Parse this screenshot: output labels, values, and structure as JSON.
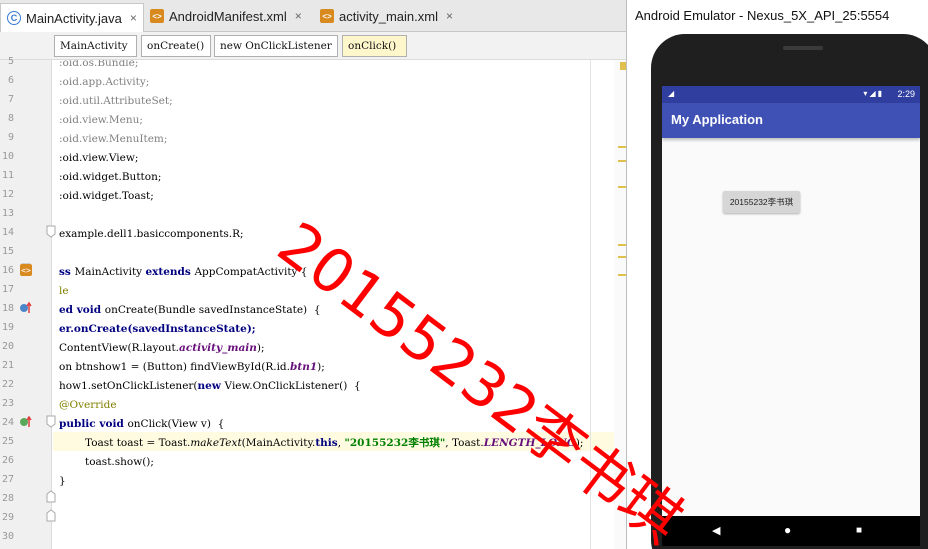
{
  "ide": {
    "tabs": [
      {
        "label": "MainActivity.java",
        "icon": "java-class-icon"
      },
      {
        "label": "AndroidManifest.xml",
        "icon": "xml-file-icon"
      },
      {
        "label": "activity_main.xml",
        "icon": "xml-file-icon"
      }
    ],
    "tab_close": "×",
    "breadcrumbs": [
      "MainActivity",
      "onCreate()",
      "new OnClickListener",
      "onClick()"
    ],
    "line_numbers": [
      "5",
      "6",
      "7",
      "8",
      "9",
      "10",
      "11",
      "12",
      "13",
      "14",
      "15",
      "16",
      "17",
      "18",
      "19",
      "20",
      "21",
      "22",
      "23",
      "24",
      "25",
      "26",
      "27",
      "28",
      "29",
      "30"
    ],
    "code": {
      "l5": ":oid.os.Bundle;",
      "l6": ":oid.app.Activity;",
      "l7": ":oid.util.AttributeSet;",
      "l8": ":oid.view.Menu;",
      "l9": ":oid.view.MenuItem;",
      "l10": ":oid.view.View;",
      "l11": ":oid.widget.Button;",
      "l12": ":oid.widget.Toast;",
      "l14": "example.dell1.basiccomponents.R;",
      "l16a": "ss ",
      "l16b": "MainActivity ",
      "l16c": "extends ",
      "l16d": "AppCompatActivity {",
      "l17": "le",
      "l18a": "ed ",
      "l18b": "void ",
      "l18c": "onCreate(Bundle savedInstanceState)  {",
      "l19": "er.onCreate(savedInstanceState);",
      "l20a": "ContentView(R.layout.",
      "l20b": "activity_main",
      "l20c": ");",
      "l21a": "on btnshow1 = (Button) findViewById(R.id.",
      "l21b": "btn1",
      "l21c": ");",
      "l22a": "how1.setOnClickListener(",
      "l22b": "new ",
      "l22c": "View.OnClickListener()  {",
      "l23": "@Override",
      "l24a": "public ",
      "l24b": "void ",
      "l24c": "onClick(View v)  {",
      "l25a": "Toast toast = Toast.",
      "l25b": "makeText",
      "l25c": "(MainActivity.",
      "l25d": "this",
      "l25e": ", ",
      "l25f": "\"20155232李书琪\"",
      "l25g": ", Toast.",
      "l25h": "LENGTH_LONG",
      "l25i": ");",
      "l26": "toast.show();",
      "l27": "}"
    }
  },
  "emulator": {
    "window_title": "Android Emulator - Nexus_5X_API_25:5554",
    "status_time": "2:29",
    "status_signal": "◢",
    "status_icons": "▾◢▮",
    "app_title": "My Application",
    "button_label": "20155232李书琪",
    "nav": {
      "back": "◀",
      "home": "●",
      "recents": "■"
    }
  },
  "watermark": "20155232李书琪",
  "colors": {
    "keyword": "#000080",
    "string": "#008000",
    "field_italic": "#660e7a",
    "annotation": "#808000",
    "app_bar": "#3f51b5",
    "status_bar": "#303f9f",
    "watermark": "#ff0000"
  }
}
